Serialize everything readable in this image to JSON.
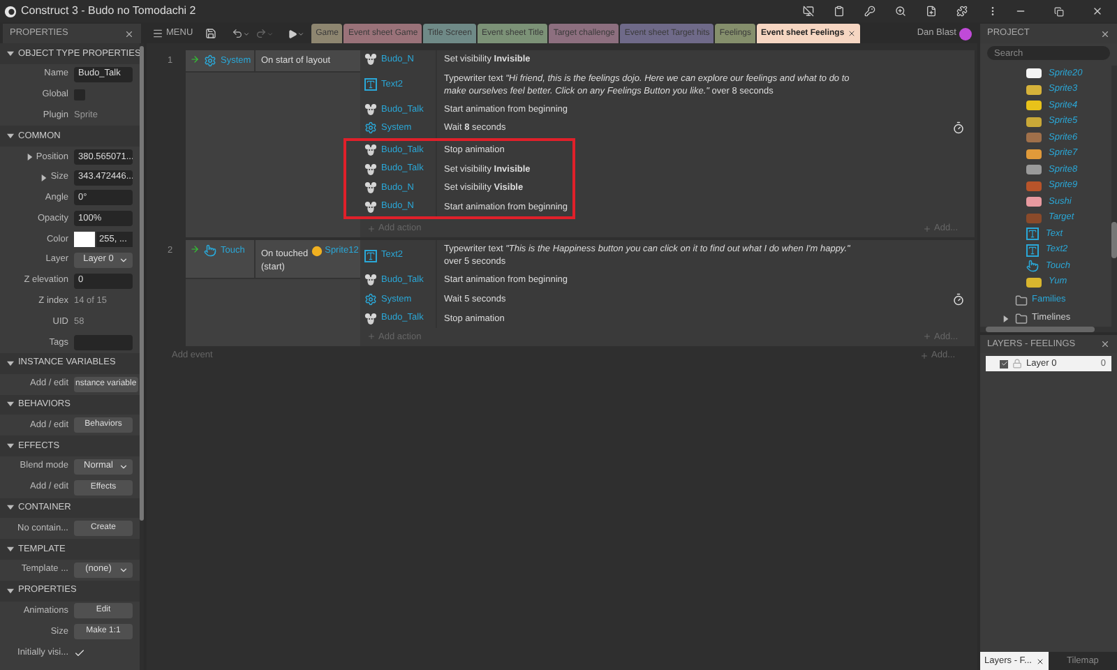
{
  "window": {
    "title": "Construct 3 - Budo no Tomodachi 2"
  },
  "toolbar": {
    "menu_label": "MENU",
    "user": "Dan Blast"
  },
  "tabs": [
    {
      "label": "Game",
      "color": "#8e8670",
      "selected": false
    },
    {
      "label": "Event sheet Game",
      "color": "#9a7279",
      "selected": false
    },
    {
      "label": "Title Screen",
      "color": "#6f8a87",
      "selected": false
    },
    {
      "label": "Event sheet Title",
      "color": "#7c9277",
      "selected": false
    },
    {
      "label": "Target challenge",
      "color": "#8d6f7f",
      "selected": false
    },
    {
      "label": "Event sheet Target hits",
      "color": "#6f6a89",
      "selected": false
    },
    {
      "label": "Feelings",
      "color": "#858f6c",
      "selected": false
    },
    {
      "label": "Event sheet Feelings",
      "color": "#f6d6c2",
      "selected": true
    }
  ],
  "properties": {
    "title": "PROPERTIES",
    "sections": [
      {
        "title": "OBJECT TYPE PROPERTIES",
        "expanded": true,
        "rows": [
          {
            "label": "Name",
            "kind": "text",
            "value": "Budo_Talk"
          },
          {
            "label": "Global",
            "kind": "checkbox",
            "checked": false
          },
          {
            "label": "Plugin",
            "kind": "static",
            "value": "Sprite"
          }
        ]
      },
      {
        "title": "COMMON",
        "expanded": true,
        "rows": [
          {
            "label": "Position",
            "kind": "text",
            "value": "380.565071...",
            "expanded": false
          },
          {
            "label": "Size",
            "kind": "text",
            "value": "343.472446...",
            "expanded": false
          },
          {
            "label": "Angle",
            "kind": "text",
            "value": "0°"
          },
          {
            "label": "Opacity",
            "kind": "text",
            "value": "100%"
          },
          {
            "label": "Color",
            "kind": "color",
            "color": "#ffffff",
            "value": "255, ..."
          },
          {
            "label": "Layer",
            "kind": "dropdown",
            "value": "Layer 0"
          },
          {
            "label": "Z elevation",
            "kind": "text",
            "value": "0"
          },
          {
            "label": "Z index",
            "kind": "static",
            "value": "14 of 15"
          },
          {
            "label": "UID",
            "kind": "static",
            "value": "58"
          },
          {
            "label": "Tags",
            "kind": "text",
            "value": ""
          }
        ]
      },
      {
        "title": "INSTANCE VARIABLES",
        "expanded": true,
        "rows": [
          {
            "label": "Add / edit",
            "kind": "button",
            "value": "nstance variable"
          }
        ]
      },
      {
        "title": "BEHAVIORS",
        "expanded": true,
        "rows": [
          {
            "label": "Add / edit",
            "kind": "button",
            "value": "Behaviors"
          }
        ]
      },
      {
        "title": "EFFECTS",
        "expanded": true,
        "rows": [
          {
            "label": "Blend mode",
            "kind": "dropdown",
            "value": "Normal"
          },
          {
            "label": "Add / edit",
            "kind": "button",
            "value": "Effects"
          }
        ]
      },
      {
        "title": "CONTAINER",
        "expanded": true,
        "rows": [
          {
            "label": "No contain...",
            "kind": "button",
            "value": "Create"
          }
        ]
      },
      {
        "title": "TEMPLATE",
        "expanded": true,
        "rows": [
          {
            "label": "Template ...",
            "kind": "dropdown",
            "value": "(none)"
          }
        ]
      },
      {
        "title": "PROPERTIES",
        "expanded": true,
        "rows": [
          {
            "label": "Animations",
            "kind": "button",
            "value": "Edit"
          },
          {
            "label": "Size",
            "kind": "button",
            "value": "Make 1:1"
          },
          {
            "label": "Initially visi...",
            "kind": "checkbox",
            "checked": true
          }
        ]
      }
    ]
  },
  "events": [
    {
      "number": "1",
      "condition": {
        "object": "System",
        "kind": "system",
        "text": "On start of layout"
      },
      "action_groups": [
        {
          "kind": "plain",
          "actions": [
            {
              "object": "Budo_N",
              "kind": "sprite",
              "text": "Set visibility **Invisible**",
              "timer": false
            },
            {
              "object": "Text2",
              "kind": "text",
              "text": "Typewriter text *\"Hi friend, this is the feelings dojo. Here we can explore our feelings and what to do to make ourselves feel better. Click on any Feelings Button you like.\"* over 8 seconds",
              "timer": false
            },
            {
              "object": "Budo_Talk",
              "kind": "sprite",
              "text": "Start animation from beginning",
              "timer": false
            },
            {
              "object": "System",
              "kind": "system",
              "text": "Wait **8** seconds",
              "timer": true
            }
          ]
        },
        {
          "kind": "highlight",
          "actions": [
            {
              "object": "Budo_Talk",
              "kind": "sprite",
              "text": "Stop animation",
              "timer": false
            },
            {
              "object": "Budo_Talk",
              "kind": "sprite",
              "text": "Set visibility **Invisible**",
              "timer": false
            },
            {
              "object": "Budo_N",
              "kind": "sprite",
              "text": "Set visibility **Visible**",
              "timer": false
            },
            {
              "object": "Budo_N",
              "kind": "sprite",
              "text": "Start animation from beginning",
              "timer": false
            }
          ]
        }
      ],
      "add_action": "Add action",
      "add_more": "Add..."
    },
    {
      "number": "2",
      "condition": {
        "object": "Touch",
        "kind": "touch",
        "text": "On touched",
        "param_object": "Sprite12",
        "suffix": "(start)"
      },
      "action_groups": [
        {
          "kind": "plain",
          "actions": [
            {
              "object": "Text2",
              "kind": "text",
              "text": "Typewriter text *\"This is the Happiness button you can click on it to find out what I do when I'm happy.\"* over 5 seconds",
              "timer": false
            },
            {
              "object": "Budo_Talk",
              "kind": "sprite",
              "text": "Start animation from beginning",
              "timer": false
            },
            {
              "object": "System",
              "kind": "system",
              "text": "Wait 5 seconds",
              "timer": true
            },
            {
              "object": "Budo_Talk",
              "kind": "sprite",
              "text": "Stop animation",
              "timer": false
            }
          ]
        }
      ],
      "add_action": "Add action",
      "add_more": "Add..."
    }
  ],
  "add_event": "Add event",
  "add_event_more": "Add...",
  "project": {
    "title": "PROJECT",
    "search": {
      "placeholder": "Search"
    },
    "items": [
      {
        "name": "Sprite20",
        "kind": "sprite",
        "color": "#f4f4f4"
      },
      {
        "name": "Sprite3",
        "kind": "sprite",
        "color": "#d6b23a"
      },
      {
        "name": "Sprite4",
        "kind": "sprite",
        "color": "#e8c21a"
      },
      {
        "name": "Sprite5",
        "kind": "sprite",
        "color": "#c9a838"
      },
      {
        "name": "Sprite6",
        "kind": "sprite",
        "color": "#a0704a"
      },
      {
        "name": "Sprite7",
        "kind": "sprite",
        "color": "#e09a3a"
      },
      {
        "name": "Sprite8",
        "kind": "sprite",
        "color": "#9a9a9a"
      },
      {
        "name": "Sprite9",
        "kind": "sprite",
        "color": "#b8542a"
      },
      {
        "name": "Sushi",
        "kind": "sprite",
        "color": "#e89aa0"
      },
      {
        "name": "Target",
        "kind": "sprite",
        "color": "#8a4a2a"
      },
      {
        "name": "Text",
        "kind": "text"
      },
      {
        "name": "Text2",
        "kind": "text"
      },
      {
        "name": "Touch",
        "kind": "touch"
      },
      {
        "name": "Yum",
        "kind": "sprite",
        "color": "#d9b62e"
      }
    ],
    "folders": [
      {
        "name": "Families",
        "expandable": false
      },
      {
        "name": "Timelines",
        "expanded": false,
        "expandable": true
      }
    ]
  },
  "layers": {
    "title": "LAYERS - FEELINGS",
    "items": [
      {
        "name": "Layer 0",
        "visible": true,
        "locked": false,
        "count": "0",
        "selected": true
      }
    ]
  },
  "bottom_tabs": [
    {
      "label": "Layers - F...",
      "selected": true
    },
    {
      "label": "Tilemap",
      "selected": false
    }
  ]
}
